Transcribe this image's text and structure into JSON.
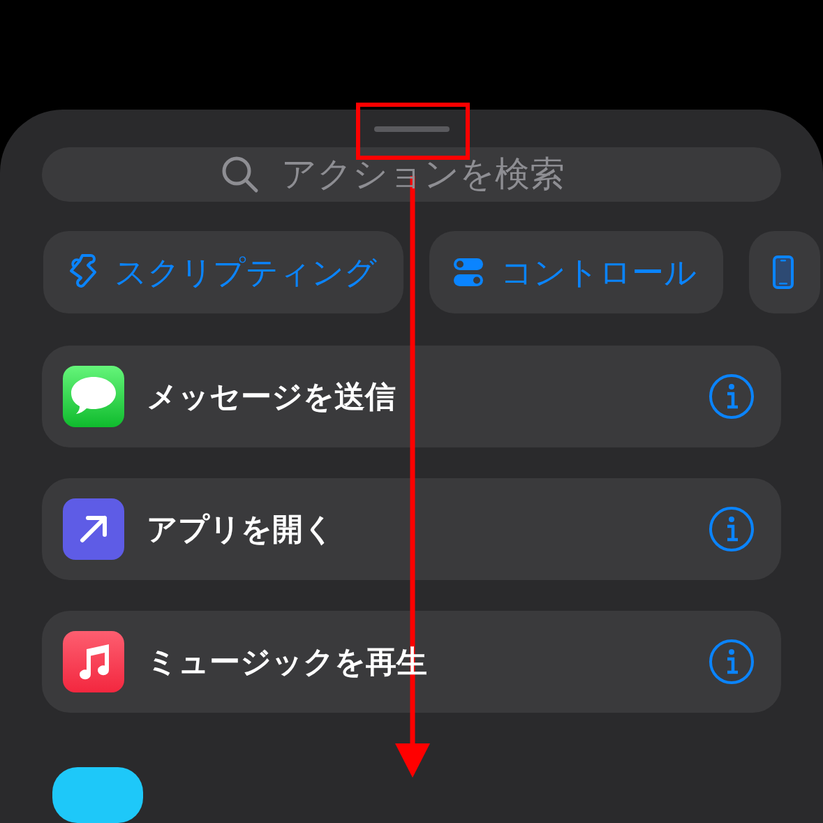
{
  "search": {
    "placeholder": "アクションを検索"
  },
  "categories": [
    {
      "kind": "scripting",
      "label": "スクリプティング"
    },
    {
      "kind": "controls",
      "label": "コントロール"
    },
    {
      "kind": "device"
    }
  ],
  "actions": [
    {
      "kind": "messages",
      "title": "メッセージを送信"
    },
    {
      "kind": "open-app",
      "title": "アプリを開く"
    },
    {
      "kind": "music",
      "title": "ミュージックを再生"
    }
  ]
}
